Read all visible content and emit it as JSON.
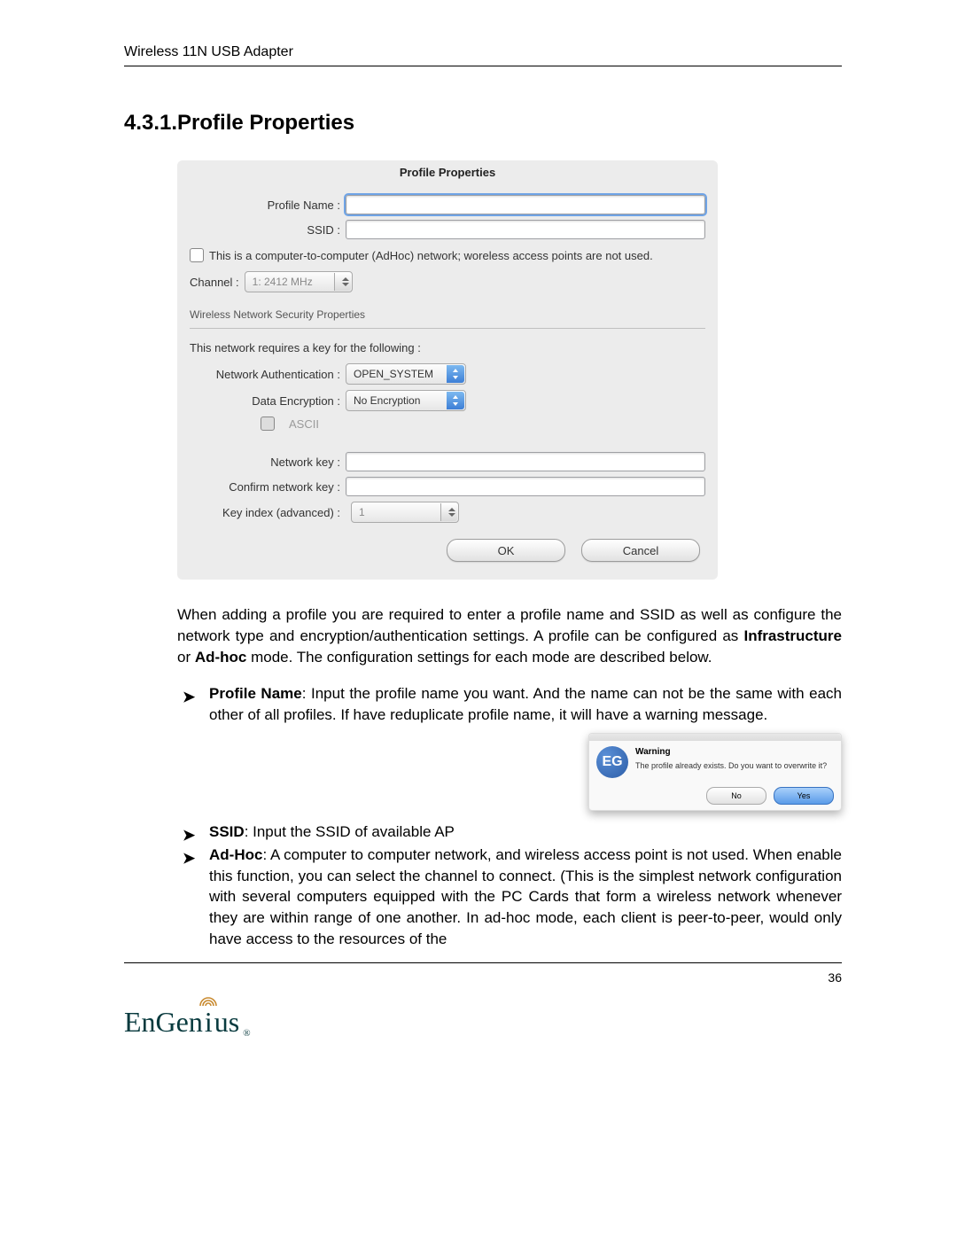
{
  "page_header": "Wireless 11N USB Adapter",
  "section_number": "4.3.1.",
  "section_title": "Profile Properties",
  "dialog": {
    "title": "Profile Properties",
    "profile_name_label": "Profile Name :",
    "profile_name_value": "",
    "ssid_label": "SSID :",
    "ssid_value": "",
    "adhoc_checkbox_label": "This is a computer-to-computer (AdHoc) network; woreless access points are not used.",
    "channel_label": "Channel :",
    "channel_value": "1: 2412 MHz",
    "security_heading": "Wireless Network Security Properties",
    "requires_text": "This network requires a key for the following :",
    "auth_label": "Network Authentication :",
    "auth_value": "OPEN_SYSTEM",
    "enc_label": "Data Encryption :",
    "enc_value": "No Encryption",
    "ascii_label": "ASCII",
    "netkey_label": "Network key :",
    "netkey_value": "",
    "confirmkey_label": "Confirm network key :",
    "confirmkey_value": "",
    "keyindex_label": "Key index (advanced) :",
    "keyindex_value": "1",
    "ok_label": "OK",
    "cancel_label": "Cancel"
  },
  "paragraph": {
    "p1a": "When adding a profile you are required to enter a profile name and SSID as well as configure the network type and encryption/authentication settings.  A profile can be configured as ",
    "p1b_bold": "Infrastructure",
    "p1c": " or ",
    "p1d_bold": "Ad-hoc",
    "p1e": " mode. The configuration settings for each mode are described below."
  },
  "bullets": {
    "b1_label": "Profile Name",
    "b1_text": ": Input the profile name you want. And the name can not be the same with each other of all profiles. If have reduplicate profile name, it will have a warning message.",
    "warning": {
      "icon_text": "EG",
      "title": "Warning",
      "msg": "The profile already exists. Do you want to overwrite it?",
      "no": "No",
      "yes": "Yes"
    },
    "b2_label": "SSID",
    "b2_text": ": Input the SSID of available AP",
    "b3_label": "Ad-Hoc",
    "b3_text": ": A computer to computer network, and wireless access point is not used. When enable this function, you can select the channel to connect. (This is the simplest network configuration with several computers equipped with the PC Cards that form a wireless network whenever they are within range of one another.  In ad-hoc mode, each client is peer-to-peer, would only have access to the resources of the"
  },
  "page_number": "36",
  "logo": "EnGenius"
}
